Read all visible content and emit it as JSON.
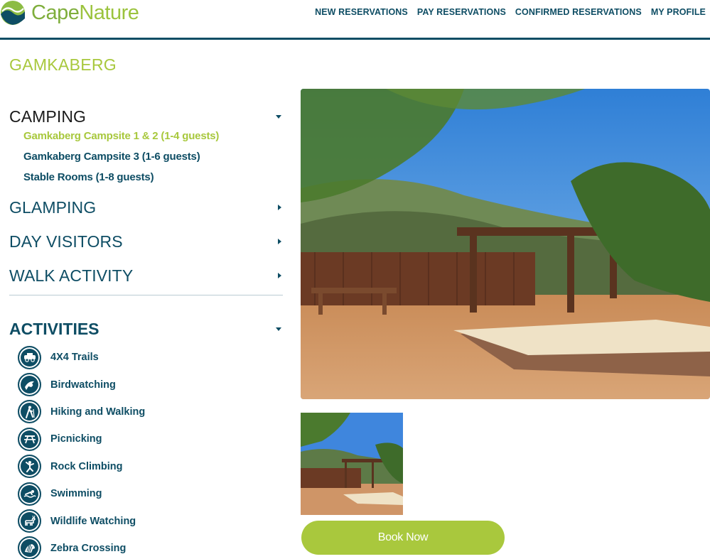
{
  "brand": {
    "name_part1": "Cape",
    "name_part2": "Nature"
  },
  "topnav": [
    {
      "label": "NEW RESERVATIONS"
    },
    {
      "label": "PAY RESERVATIONS"
    },
    {
      "label": "CONFIRMED RESERVATIONS"
    },
    {
      "label": "MY PROFILE"
    }
  ],
  "page": {
    "title": "GAMKABERG"
  },
  "sidebar": {
    "sections": [
      {
        "label": "CAMPING",
        "expanded": true,
        "items": [
          {
            "label": "Gamkaberg Campsite 1 & 2 (1-4 guests)",
            "active": true
          },
          {
            "label": "Gamkaberg Campsite 3 (1-6 guests)",
            "active": false
          },
          {
            "label": "Stable Rooms (1-8 guests)",
            "active": false
          }
        ]
      },
      {
        "label": "GLAMPING",
        "expanded": false
      },
      {
        "label": "DAY VISITORS",
        "expanded": false
      },
      {
        "label": "WALK ACTIVITY",
        "expanded": false
      }
    ],
    "activities_heading": "ACTIVITIES",
    "activities": [
      {
        "label": "4X4 Trails",
        "icon": "4x4-icon"
      },
      {
        "label": "Birdwatching",
        "icon": "bird-icon"
      },
      {
        "label": "Hiking and Walking",
        "icon": "hiker-icon"
      },
      {
        "label": "Picnicking",
        "icon": "picnic-table-icon"
      },
      {
        "label": "Rock Climbing",
        "icon": "climber-icon"
      },
      {
        "label": "Swimming",
        "icon": "swimmer-icon"
      },
      {
        "label": "Wildlife Watching",
        "icon": "antelope-icon"
      },
      {
        "label": "Zebra Crossing",
        "icon": "zebra-icon"
      }
    ]
  },
  "booking": {
    "button_label": "Book Now"
  },
  "colors": {
    "navy": "#0e4d64",
    "lime": "#a9c83d",
    "logo_green": "#7fae3c"
  }
}
